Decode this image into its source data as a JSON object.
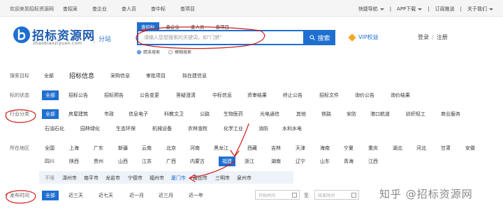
{
  "topbar": {
    "welcome": "欢迎来到招标资源网",
    "nav": [
      "查招采",
      "查企业",
      "查人员",
      "查中标",
      "查项目"
    ],
    "quick_nav": "快捷导航",
    "app_download": "APP下载",
    "subscribe": "订阅推送",
    "about": "关于我们"
  },
  "header": {
    "logo_title": "招标资源网",
    "logo_domain": "zhaobiaoziyuan.com",
    "site_switch": "分站",
    "search_tabs": [
      "查招标",
      "查企业",
      "查人员",
      "查项目"
    ],
    "search_placeholder": "请输入您想搜索的关键词，如\"门禁\"",
    "search_button": "搜索",
    "modes": [
      "精准搜索",
      "模糊搜索"
    ],
    "vip": "VIP权益",
    "login": "登录",
    "register": "注册"
  },
  "filters": {
    "search_target": {
      "label": "搜索目标",
      "options": [
        "全部",
        "招标信息",
        "采购信息",
        "审批项目",
        "拟在建信息"
      ]
    },
    "status": {
      "label": "标的状态",
      "options": [
        "全部",
        "招标公告",
        "招标预告",
        "公告变更",
        "答疑澄清",
        "中标信息",
        "资审结果",
        "终止公告",
        "招标文件",
        "询价公告",
        "询价结果"
      ]
    },
    "industry": {
      "label": "行业分类",
      "row1": [
        "全部",
        "房屋建筑",
        "市政",
        "信息电子",
        "科教文卫",
        "公路",
        "生物医药",
        "光电通信",
        "其他",
        "铁路",
        "安防",
        "港口航道",
        "纺织轻工",
        "商业服务"
      ],
      "row2": [
        "石油石化",
        "园林绿化",
        "生态环保",
        "机械设备",
        "农林渔牧",
        "化学工业",
        "消防",
        "水利水电"
      ]
    },
    "region": {
      "label": "所在地区",
      "row1": [
        "全国",
        "上海",
        "广东",
        "新疆",
        "云南",
        "北京",
        "河南",
        "黑龙江",
        "西藏",
        "吉林",
        "天津",
        "海南",
        "宁夏",
        "重庆",
        "湖北",
        "河北",
        "甘肃",
        "安徽"
      ],
      "row2": [
        "四川",
        "陕西",
        "贵州",
        "山西",
        "江苏",
        "广西",
        "内蒙古",
        "福建",
        "浙江",
        "湖南",
        "辽宁",
        "山东",
        "青海",
        "江西"
      ],
      "cities": [
        "不限",
        "漳州市",
        "南平市",
        "龙岩市",
        "宁德市",
        "福州市",
        "厦门市",
        "莆田市",
        "三明市",
        "泉州市"
      ]
    },
    "date": {
      "label": "发布时间",
      "options": [
        "全部",
        "近三天",
        "近七天",
        "近一月",
        "近三月",
        "近一年"
      ],
      "start_placeholder": "开始时间",
      "to": "至",
      "end_placeholder": "结束时间"
    }
  },
  "watermark": "知乎 @招标资源网",
  "colors": {
    "accent": "#1e6fd0",
    "annotation": "#d01c1c"
  }
}
